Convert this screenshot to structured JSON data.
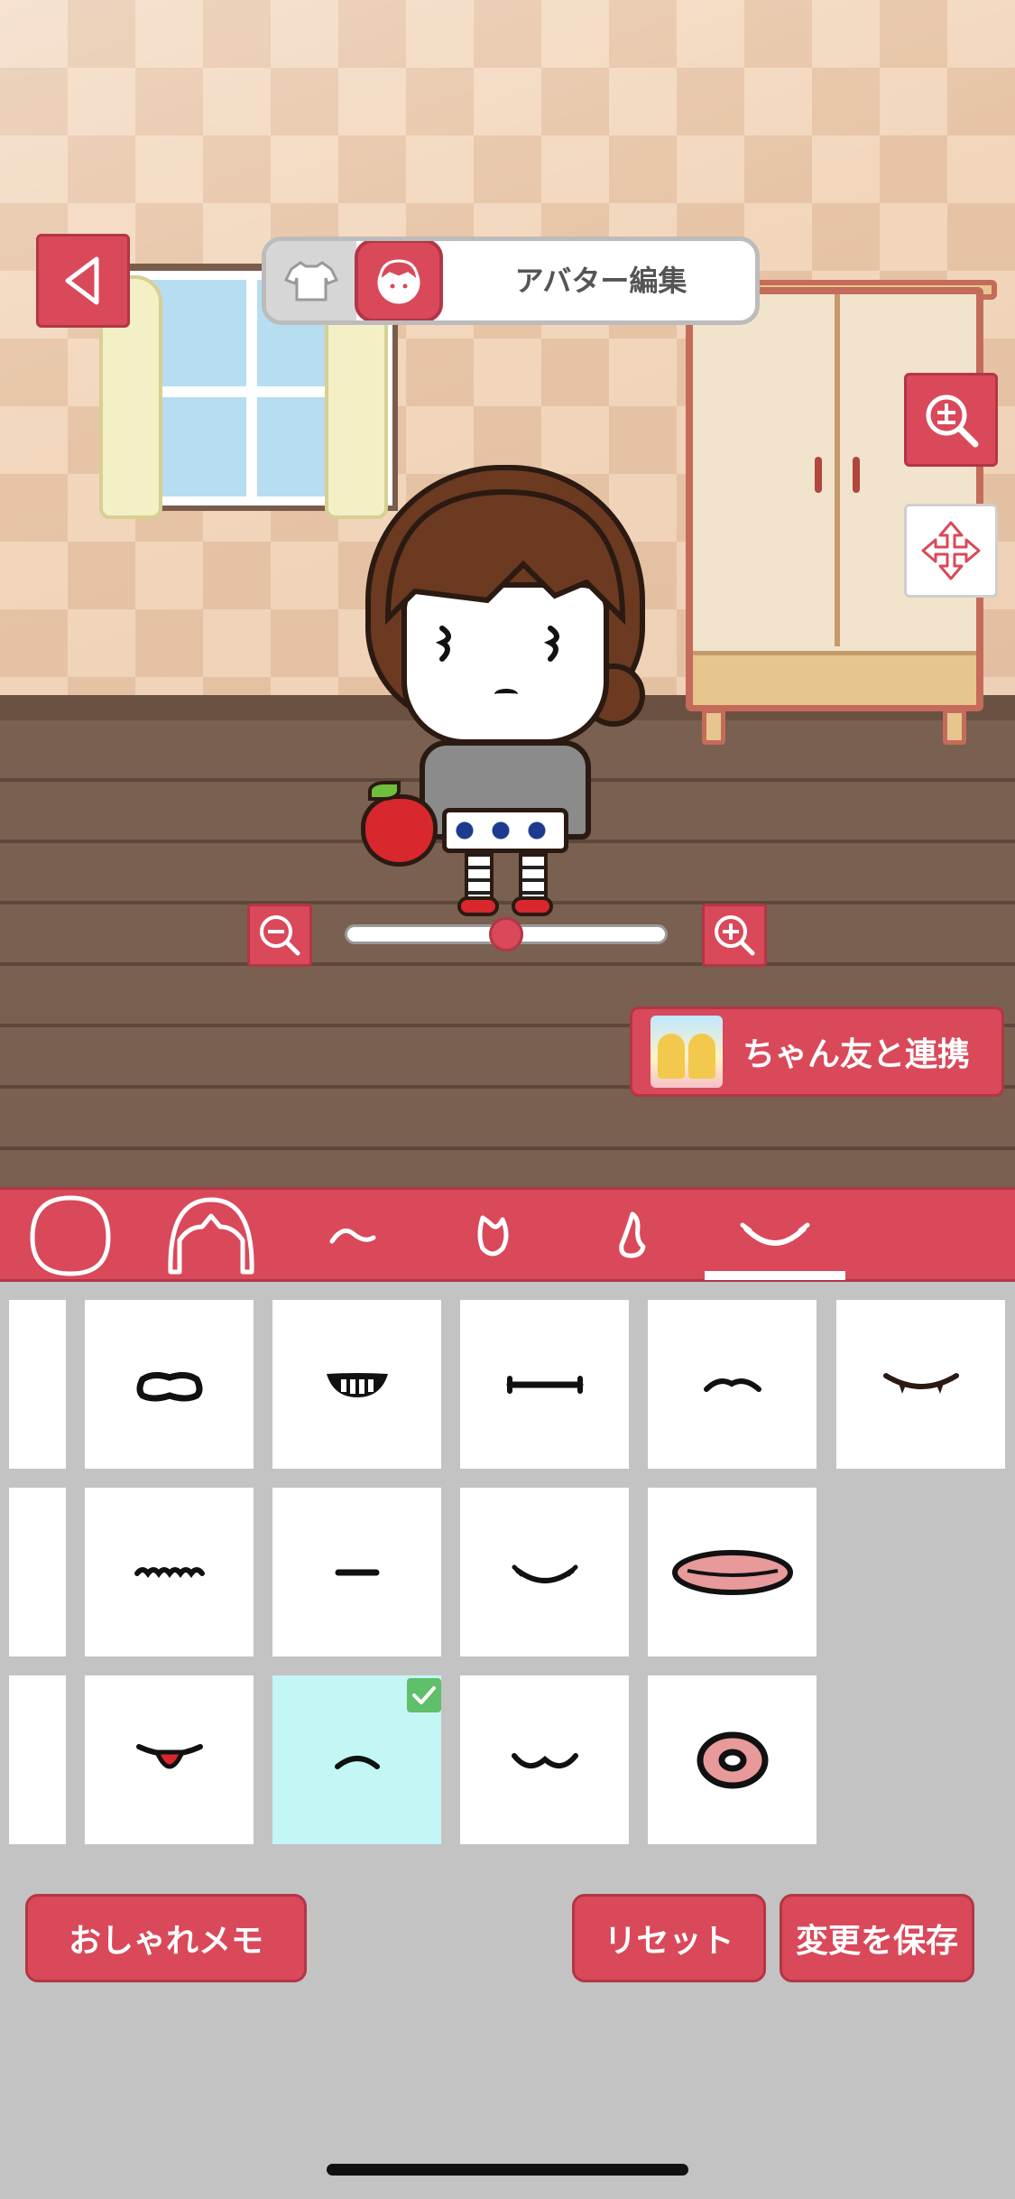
{
  "header": {
    "title": "アバター編集"
  },
  "zoom": {
    "level": 0.5
  },
  "link": {
    "label": "ちゃん友と連携"
  },
  "categories": {
    "items": [
      "face-shape",
      "hair",
      "eyebrows",
      "eyes",
      "nose",
      "mouth"
    ],
    "selected": "mouth"
  },
  "grid": {
    "selected_index": 11
  },
  "buttons": {
    "memo": "おしゃれメモ",
    "reset": "リセット",
    "save": "変更を保存"
  },
  "colors": {
    "accent": "#d9495a",
    "selected_cell": "#c4f6f6",
    "check": "#5fbf6b",
    "background": "#c3c3c3"
  }
}
